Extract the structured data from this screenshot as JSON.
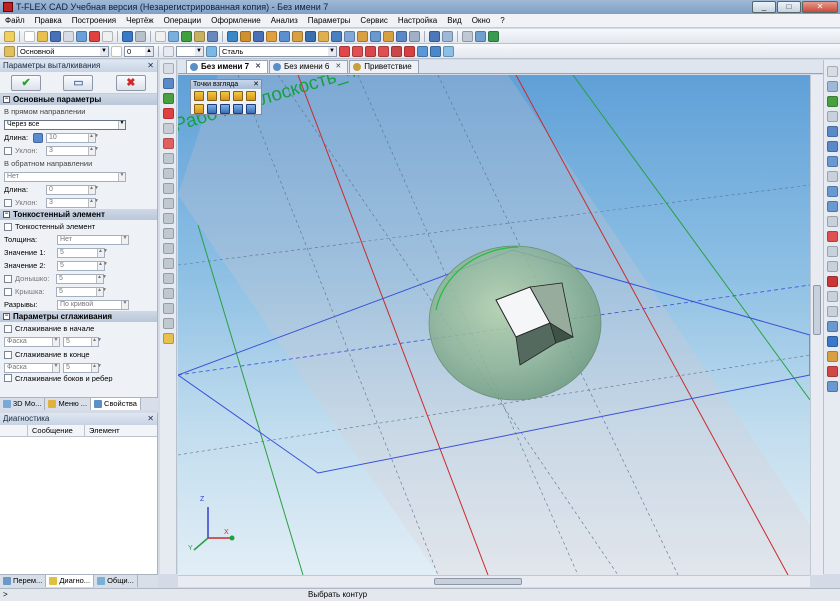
{
  "window": {
    "title": "T-FLEX CAD Учебная версия (Незарегистрированная копия) - Без имени 7",
    "buttons": [
      "_",
      "□",
      "✕"
    ]
  },
  "menu": [
    "Файл",
    "Правка",
    "Построения",
    "Чертёж",
    "Операции",
    "Оформление",
    "Анализ",
    "Параметры",
    "Сервис",
    "Настройка",
    "Вид",
    "Окно",
    "?"
  ],
  "toolbar2": {
    "layer": "Основной",
    "level": "0",
    "material": "Сталь"
  },
  "panel": {
    "title": "Параметры выталкивания",
    "sections": {
      "main": "Основные параметры",
      "thin": "Тонкостенный элемент",
      "smooth": "Параметры сглаживания"
    },
    "forward": {
      "group": "В прямом направлении",
      "mode": "Через все",
      "length_label": "Длина:",
      "length": "10",
      "slope_label": "Уклон:",
      "slope": "3"
    },
    "backward": {
      "group": "В обратном направлении",
      "mode": "Нет",
      "length_label": "Длина:",
      "length": "0",
      "slope_label": "Уклон:",
      "slope": "3"
    },
    "thinwall": {
      "check": "Тонкостенный элемент",
      "thickness_label": "Толщина:",
      "thickness": "Нет",
      "v1_label": "Значение 1:",
      "v1": "5",
      "v2_label": "Значение 2:",
      "v2": "5",
      "bottom_label": "Донышко:",
      "bottom": "5",
      "lid_label": "Крышка:",
      "lid": "5",
      "breaks_label": "Разрывы:",
      "breaks": "По кривой"
    },
    "smoothing": {
      "start": "Сглаживание в начале",
      "start_type": "Фаска",
      "start_val": "5",
      "end": "Сглаживание в конце",
      "end_type": "Фаска",
      "end_val": "5",
      "last": "Сглаживание боков и ребер"
    }
  },
  "panel_tabs": [
    "3D Мо...",
    "Меню ...",
    "Свойства"
  ],
  "diagnostics": {
    "title": "Диагностика",
    "cols": [
      "Сообщение",
      "Элемент"
    ]
  },
  "bottom_tabs": [
    "Перем...",
    "Диагно...",
    "Общи..."
  ],
  "doc_tabs": [
    "Без имени 7",
    "Без имени 6",
    "Приветствие"
  ],
  "view_toolbar": {
    "title": "Точки взгляда"
  },
  "viewport": {
    "plane_label": "Рабочая плоскость_4",
    "axis_x": "X",
    "axis_y": "Y",
    "axis_z": "Z"
  },
  "status": {
    "prompt": ">",
    "message": "Выбрать контур"
  }
}
